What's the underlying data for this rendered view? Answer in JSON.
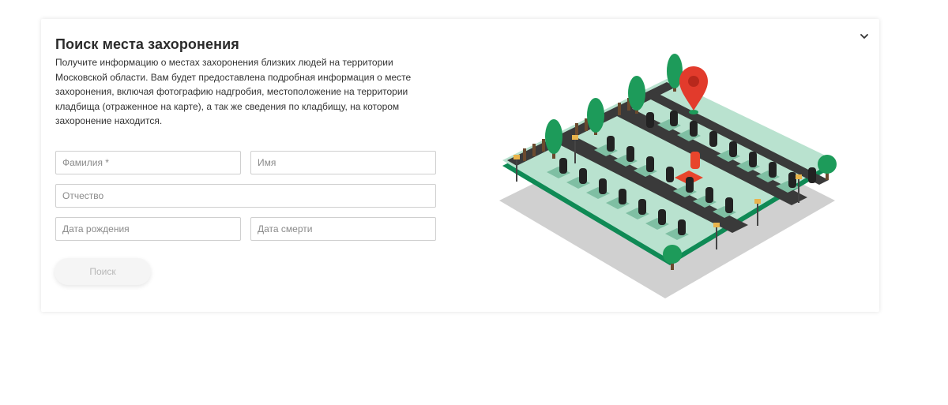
{
  "card": {
    "title": "Поиск места захоронения",
    "description": "Получите информацию о местах захоронения близких людей на территории Московской области. Вам будет предоставлена подробная информация о месте захоронения, включая фотографию надгробия, местоположение на территории кладбища (отраженное на карте), а так же сведения по кладбищу, на котором захоронение находится.",
    "collapse_icon": "chevron-down-icon"
  },
  "form": {
    "surname_placeholder": "Фамилия *",
    "name_placeholder": "Имя",
    "patronymic_placeholder": "Отчество",
    "birth_date_placeholder": "Дата рождения",
    "death_date_placeholder": "Дата смерти",
    "search_label": "Поиск"
  },
  "illustration": {
    "icon": "cemetery-map-illustration",
    "pin_icon": "location-pin-icon",
    "colors": {
      "grass": "#b9e2cf",
      "edge": "#0f8a55",
      "road": "#3a3a3a",
      "shadow": "#d0d0d0",
      "tree": "#1d9b5a",
      "pin": "#e23b2c",
      "grave": "#222222",
      "highlight": "#e8452c"
    }
  }
}
